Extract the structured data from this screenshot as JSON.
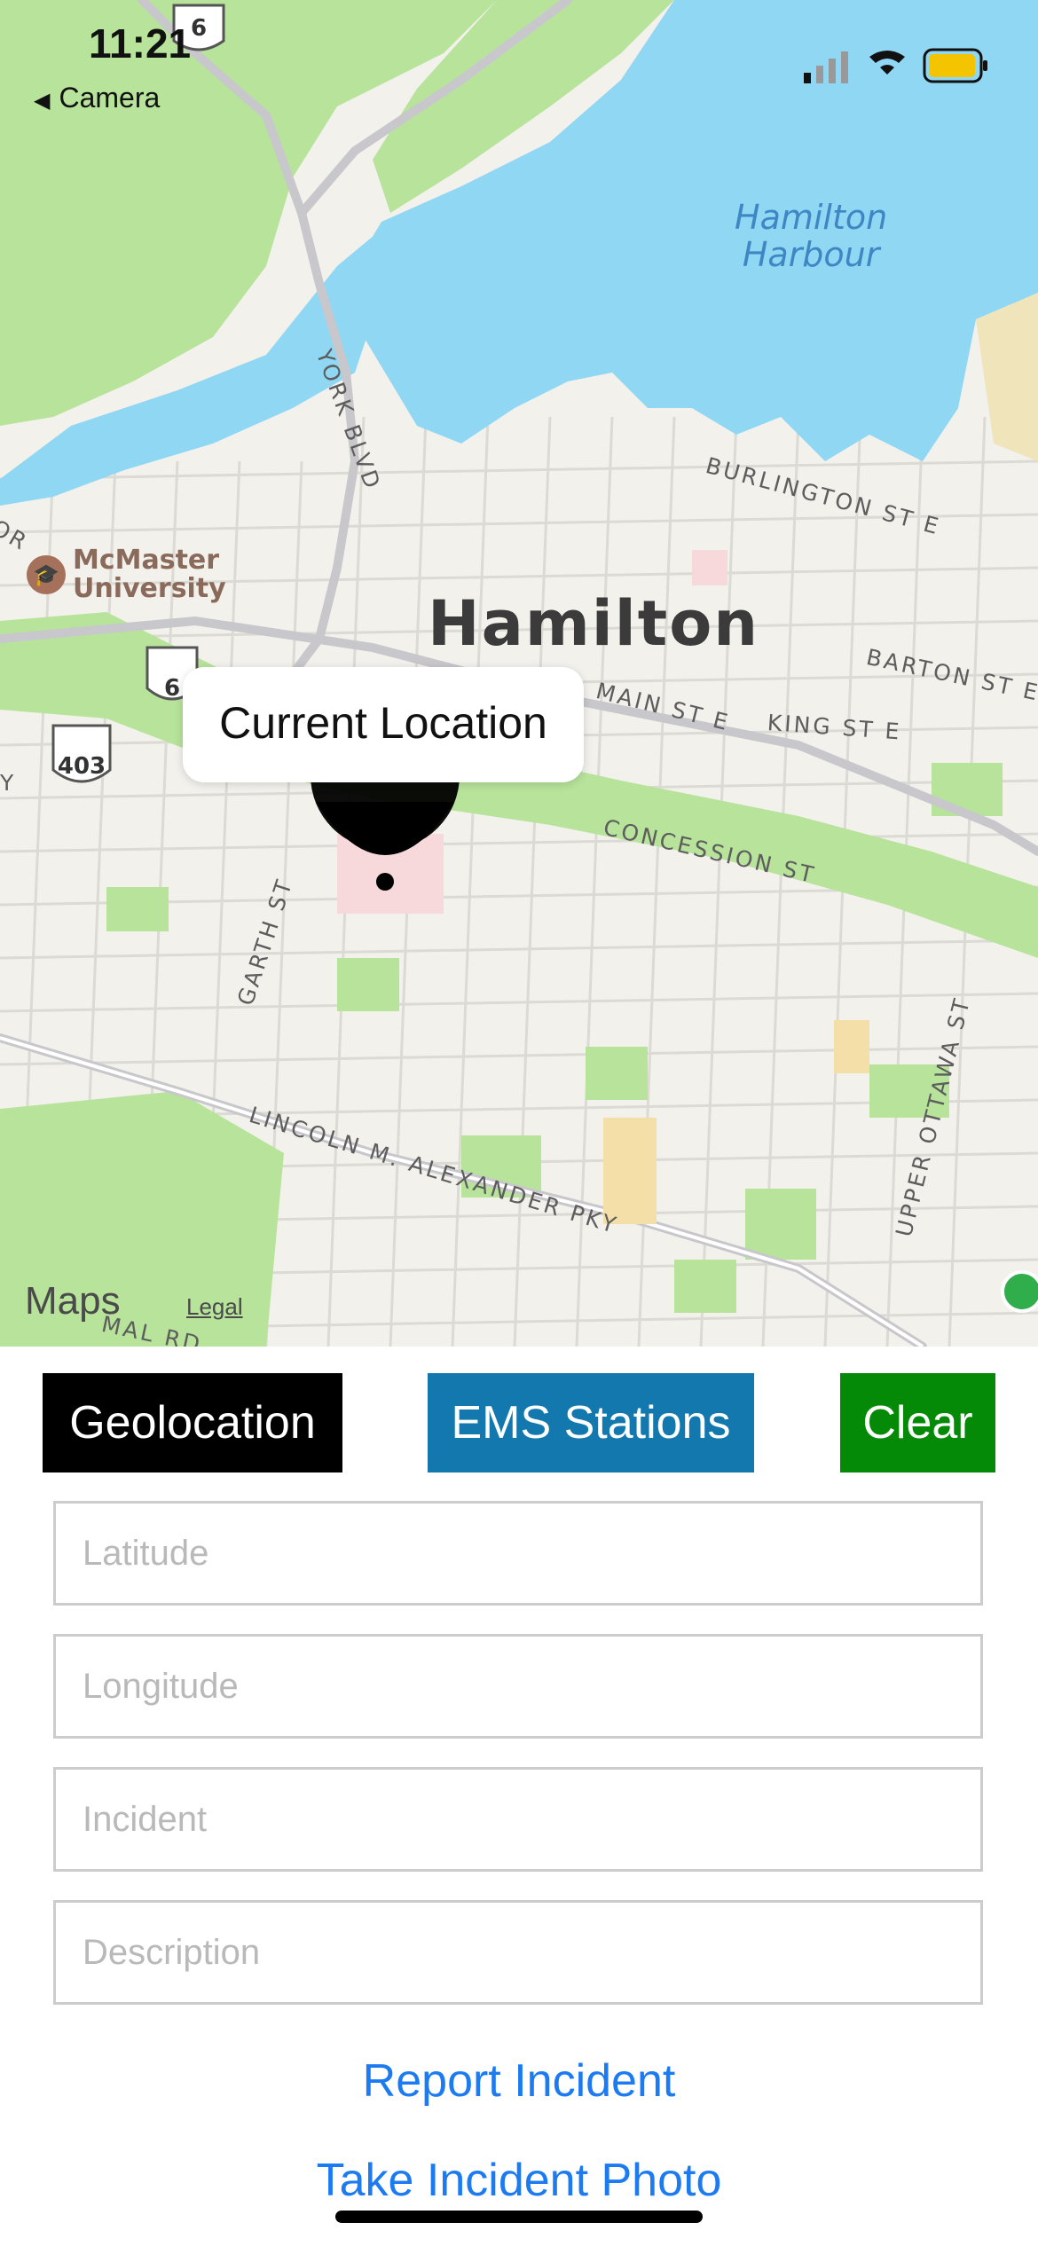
{
  "status_bar": {
    "time": "11:21",
    "back_app": "Camera",
    "back_icon": "back-triangle-icon",
    "battery_color": "#f5c400"
  },
  "map": {
    "water_label": "Hamilton\nHarbour",
    "city_label": "Hamilton",
    "poi_label": "McMaster\nUniversity",
    "streets": {
      "york": "YORK BLVD",
      "burlington": "BURLINGTON ST E",
      "barton": "BARTON ST E",
      "main": "MAIN ST E",
      "king": "KING ST E",
      "concession": "CONCESSION ST",
      "garth": "GARTH ST",
      "lincoln": "LINCOLN M. ALEXANDER PKY",
      "ottawa": "UPPER OTTAWA ST",
      "edge_or": "OR",
      "edge_y": "Y",
      "mal": "MAL RD"
    },
    "highway_shields": [
      "6",
      "6",
      "403"
    ],
    "callout": "Current Location",
    "brand": "Maps",
    "legal": "Legal",
    "colors": {
      "water": "#8fd7f3",
      "park": "#b7e39b",
      "land": "#f3f1ec",
      "road": "#c8c8cc"
    }
  },
  "buttons": {
    "geolocation": "Geolocation",
    "ems_stations": "EMS Stations",
    "clear": "Clear"
  },
  "form": {
    "latitude_placeholder": "Latitude",
    "longitude_placeholder": "Longitude",
    "incident_placeholder": "Incident",
    "description_placeholder": "Description"
  },
  "actions": {
    "report": "Report Incident",
    "photo": "Take Incident Photo"
  },
  "colors": {
    "geolocation_bg": "#000000",
    "ems_bg": "#1378ae",
    "clear_bg": "#058a07",
    "link": "#1d7bf2"
  }
}
